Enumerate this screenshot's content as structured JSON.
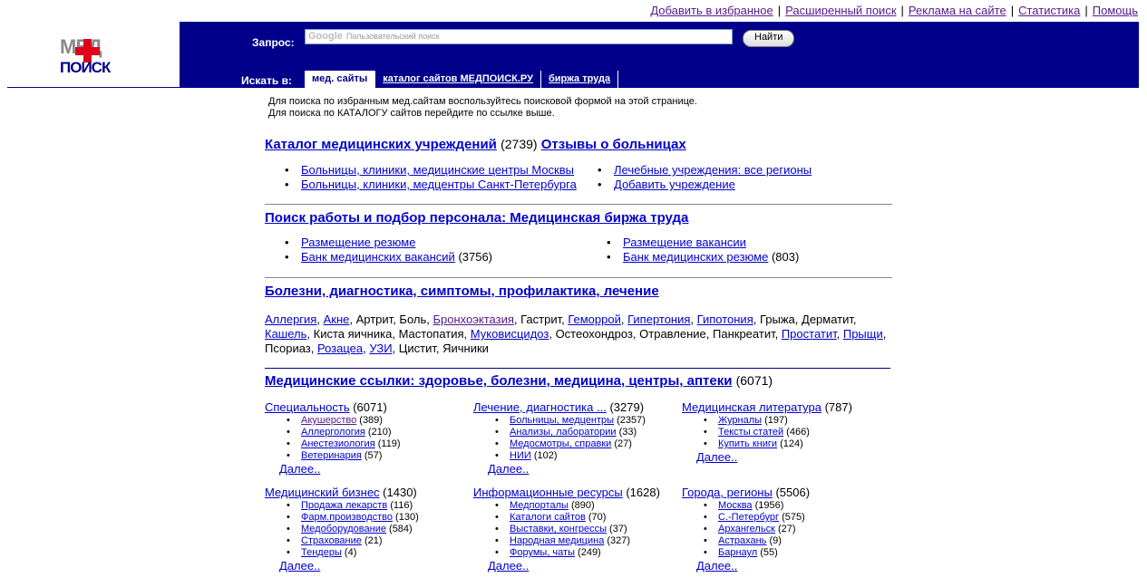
{
  "topnav": [
    "Добавить в избранное",
    "Расширенный поиск",
    "Реклама на сайте",
    "Статистика",
    "Помощь"
  ],
  "logo": {
    "text_top": "МЕД",
    "text_bottom": "ПОИСК"
  },
  "search": {
    "label": "Запрос:",
    "google": "Google",
    "placeholder": "Пользовательский поиск",
    "button": "Найти"
  },
  "search_in": {
    "label": "Искать в:",
    "tabs": [
      "мед. сайты",
      "каталог сайтов МЕДПОИСК.РУ",
      "биржа труда"
    ]
  },
  "intro": [
    "Для поиска по избранным мед.сайтам воспользуйтесь поисковой формой на этой странице.",
    "Для поиска по КАТАЛОГУ сайтов перейдите по ссылке выше."
  ],
  "catalog": {
    "title": "Каталог медицинских учреждений",
    "count": "(2739)",
    "reviews": "Отзывы о больницах",
    "left": [
      "Больницы, клиники, медицинские центры Москвы",
      "Больницы, клиники, медцентры Санкт-Петербурга"
    ],
    "right": [
      "Лечебные учреждения: все регионы",
      "Добавить учреждение"
    ]
  },
  "jobs": {
    "title": "Поиск работы и подбор персонала: Медицинская биржа труда",
    "left": [
      {
        "t": "Размещение резюме",
        "c": ""
      },
      {
        "t": "Банк медицинских вакансий",
        "c": "(3756)"
      }
    ],
    "right": [
      {
        "t": "Размещение вакансии",
        "c": ""
      },
      {
        "t": "Банк медицинских резюме",
        "c": "(803)"
      }
    ]
  },
  "diseases": {
    "title": "Болезни, диагностика, симптомы, профилактика, лечение",
    "items": [
      {
        "t": "Аллергия",
        "l": true
      },
      {
        "t": "Акне",
        "l": true
      },
      {
        "t": "Артрит",
        "l": false
      },
      {
        "t": "Боль",
        "l": false
      },
      {
        "t": "Бронхоэктазия",
        "l": true,
        "v": true
      },
      {
        "t": "Гастрит",
        "l": false
      },
      {
        "t": "Геморрой",
        "l": true
      },
      {
        "t": "Гипертония",
        "l": true
      },
      {
        "t": "Гипотония",
        "l": true
      },
      {
        "t": "Грыжа",
        "l": false
      },
      {
        "t": "Дерматит",
        "l": false
      },
      {
        "t": "Кашель",
        "l": true
      },
      {
        "t": "Киста яичника",
        "l": false
      },
      {
        "t": "Мастопатия",
        "l": false
      },
      {
        "t": "Муковисцидоз",
        "l": true
      },
      {
        "t": "Остеохондроз",
        "l": false
      },
      {
        "t": "Отравление",
        "l": false
      },
      {
        "t": "Панкреатит",
        "l": false
      },
      {
        "t": "Простатит",
        "l": true
      },
      {
        "t": "Прыщи",
        "l": true
      },
      {
        "t": "Псориаз",
        "l": false
      },
      {
        "t": "Розацеа",
        "l": true
      },
      {
        "t": "УЗИ",
        "l": true
      },
      {
        "t": "Цистит",
        "l": false
      },
      {
        "t": "Яичники",
        "l": false
      }
    ]
  },
  "links": {
    "title": "Медицинские ссылки: здоровье, болезни, медицина, центры, аптеки",
    "count": "(6071)",
    "more": "Далее..",
    "cats": [
      {
        "t": "Специальность",
        "c": "(6071)",
        "items": [
          {
            "t": "Акушерство",
            "c": "(389)",
            "v": true
          },
          {
            "t": "Аллергология",
            "c": "(210)"
          },
          {
            "t": "Анестезиология",
            "c": "(119)"
          },
          {
            "t": "Ветеринария",
            "c": "(57)"
          }
        ]
      },
      {
        "t": "Лечение, диагностика ...",
        "c": "(3279)",
        "items": [
          {
            "t": "Больницы, медцентры",
            "c": "(2357)"
          },
          {
            "t": "Анализы, лаборатории",
            "c": "(33)"
          },
          {
            "t": "Медосмотры, справки",
            "c": "(27)"
          },
          {
            "t": "НИИ",
            "c": "(102)"
          }
        ]
      },
      {
        "t": "Медицинская литература",
        "c": "(787)",
        "items": [
          {
            "t": "Журналы",
            "c": "(197)"
          },
          {
            "t": "Тексты статей",
            "c": "(466)"
          },
          {
            "t": "Купить книги",
            "c": "(124)"
          }
        ]
      },
      {
        "t": "Медицинский бизнес",
        "c": "(1430)",
        "items": [
          {
            "t": "Продажа лекарств",
            "c": "(116)"
          },
          {
            "t": "Фарм.производство",
            "c": "(130)"
          },
          {
            "t": "Медоборудование",
            "c": "(584)"
          },
          {
            "t": "Страхование",
            "c": "(21)"
          },
          {
            "t": "Тендеры",
            "c": "(4)"
          }
        ]
      },
      {
        "t": "Информационные ресурсы",
        "c": "(1628)",
        "items": [
          {
            "t": "Медпорталы",
            "c": "(890)"
          },
          {
            "t": "Каталоги сайтов",
            "c": "(70)"
          },
          {
            "t": "Выставки, конгрессы",
            "c": "(37)"
          },
          {
            "t": "Народная медицина",
            "c": "(327)"
          },
          {
            "t": "Форумы, чаты",
            "c": "(249)"
          }
        ]
      },
      {
        "t": "Города, регионы",
        "c": "(5506)",
        "items": [
          {
            "t": "Москва",
            "c": "(1956)"
          },
          {
            "t": "С.-Петербург",
            "c": "(575)"
          },
          {
            "t": "Архангельск",
            "c": "(27)"
          },
          {
            "t": "Астрахань",
            "c": "(9)"
          },
          {
            "t": "Барнаул",
            "c": "(55)"
          }
        ]
      }
    ]
  }
}
